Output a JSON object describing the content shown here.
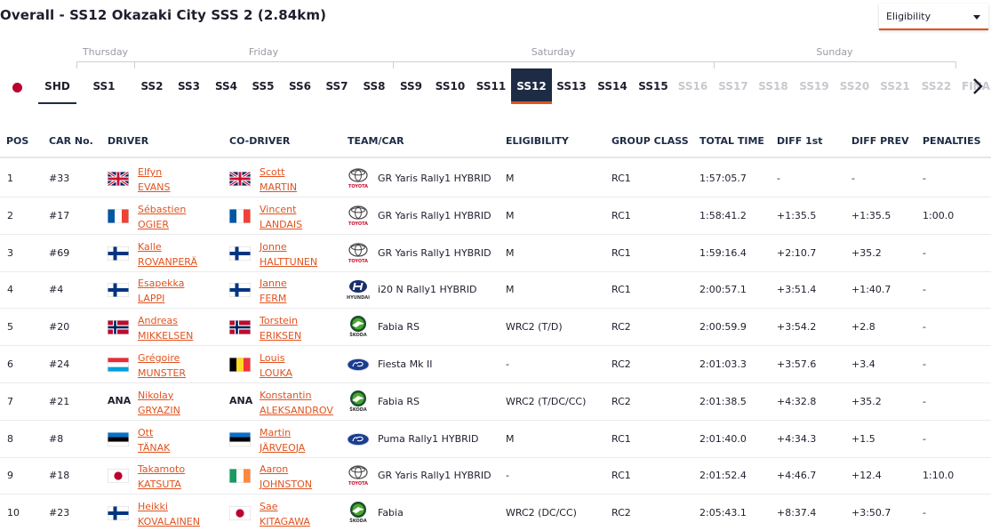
{
  "header": {
    "title": "Overall - SS12 Okazaki City SSS 2 (2.84km)"
  },
  "eligibility": {
    "label": "Eligibility"
  },
  "days": [
    "Thursday",
    "Friday",
    "Saturday",
    "Sunday"
  ],
  "stages": [
    {
      "label": "SHD",
      "state": "shd"
    },
    {
      "label": "SS1",
      "state": "done"
    },
    {
      "label": "SS2",
      "state": "done"
    },
    {
      "label": "SS3",
      "state": "done"
    },
    {
      "label": "SS4",
      "state": "done"
    },
    {
      "label": "SS5",
      "state": "done"
    },
    {
      "label": "SS6",
      "state": "done"
    },
    {
      "label": "SS7",
      "state": "done"
    },
    {
      "label": "SS8",
      "state": "done"
    },
    {
      "label": "SS9",
      "state": "done"
    },
    {
      "label": "SS10",
      "state": "done"
    },
    {
      "label": "SS11",
      "state": "done"
    },
    {
      "label": "SS12",
      "state": "active"
    },
    {
      "label": "SS13",
      "state": "done"
    },
    {
      "label": "SS14",
      "state": "done"
    },
    {
      "label": "SS15",
      "state": "done"
    },
    {
      "label": "SS16",
      "state": "future"
    },
    {
      "label": "SS17",
      "state": "future"
    },
    {
      "label": "SS18",
      "state": "future"
    },
    {
      "label": "SS19",
      "state": "future"
    },
    {
      "label": "SS20",
      "state": "future"
    },
    {
      "label": "SS21",
      "state": "future"
    },
    {
      "label": "SS22",
      "state": "future"
    },
    {
      "label": "FINAL",
      "state": "future"
    }
  ],
  "columns": {
    "pos": "POS",
    "car": "CAR No.",
    "driver": "DRIVER",
    "codriver": "CO-DRIVER",
    "team": "TEAM/CAR",
    "eligibility": "ELIGIBILITY",
    "group": "GROUP CLASS",
    "total": "TOTAL TIME",
    "diff1": "DIFF 1st",
    "diffprev": "DIFF PREV",
    "penalties": "PENALTIES"
  },
  "rows": [
    {
      "pos": "1",
      "car": "#33",
      "d_flag": "gb",
      "d_first": "Elfyn",
      "d_last": "EVANS",
      "c_flag": "gb",
      "c_first": "Scott",
      "c_last": "MARTIN",
      "brand": "toyota",
      "team": "GR Yaris Rally1 HYBRID",
      "elig": "M",
      "group": "RC1",
      "total": "1:57:05.7",
      "diff1": "-",
      "diffprev": "-",
      "pen": "-"
    },
    {
      "pos": "2",
      "car": "#17",
      "d_flag": "fr",
      "d_first": "Sébastien",
      "d_last": "OGIER",
      "c_flag": "fr",
      "c_first": "Vincent",
      "c_last": "LANDAIS",
      "brand": "toyota",
      "team": "GR Yaris Rally1 HYBRID",
      "elig": "M",
      "group": "RC1",
      "total": "1:58:41.2",
      "diff1": "+1:35.5",
      "diffprev": "+1:35.5",
      "pen": "1:00.0"
    },
    {
      "pos": "3",
      "car": "#69",
      "d_flag": "fi",
      "d_first": "Kalle",
      "d_last": "ROVANPERÄ",
      "c_flag": "fi",
      "c_first": "Jonne",
      "c_last": "HALTTUNEN",
      "brand": "toyota",
      "team": "GR Yaris Rally1 HYBRID",
      "elig": "M",
      "group": "RC1",
      "total": "1:59:16.4",
      "diff1": "+2:10.7",
      "diffprev": "+35.2",
      "pen": "-"
    },
    {
      "pos": "4",
      "car": "#4",
      "d_flag": "fi",
      "d_first": "Esapekka",
      "d_last": "LAPPI",
      "c_flag": "fi",
      "c_first": "Janne",
      "c_last": "FERM",
      "brand": "hyundai",
      "team": "i20 N Rally1 HYBRID",
      "elig": "M",
      "group": "RC1",
      "total": "2:00:57.1",
      "diff1": "+3:51.4",
      "diffprev": "+1:40.7",
      "pen": "-"
    },
    {
      "pos": "5",
      "car": "#20",
      "d_flag": "no",
      "d_first": "Andreas",
      "d_last": "MIKKELSEN",
      "c_flag": "no",
      "c_first": "Torstein",
      "c_last": "ERIKSEN",
      "brand": "skoda",
      "team": "Fabia RS",
      "elig": "WRC2 (T/D)",
      "group": "RC2",
      "total": "2:00:59.9",
      "diff1": "+3:54.2",
      "diffprev": "+2.8",
      "pen": "-"
    },
    {
      "pos": "6",
      "car": "#24",
      "d_flag": "lu",
      "d_first": "Grégoire",
      "d_last": "MUNSTER",
      "c_flag": "be",
      "c_first": "Louis",
      "c_last": "LOUKA",
      "brand": "ford",
      "team": "Fiesta Mk II",
      "elig": "-",
      "group": "RC2",
      "total": "2:01:03.3",
      "diff1": "+3:57.6",
      "diffprev": "+3.4",
      "pen": "-"
    },
    {
      "pos": "7",
      "car": "#21",
      "d_flag": "ana",
      "d_first": "Nikolay",
      "d_last": "GRYAZIN",
      "c_flag": "ana",
      "c_first": "Konstantin",
      "c_last": "ALEKSANDROV",
      "brand": "skoda",
      "team": "Fabia RS",
      "elig": "WRC2 (T/DC/CC)",
      "group": "RC2",
      "total": "2:01:38.5",
      "diff1": "+4:32.8",
      "diffprev": "+35.2",
      "pen": "-"
    },
    {
      "pos": "8",
      "car": "#8",
      "d_flag": "ee",
      "d_first": "Ott",
      "d_last": "TÄNAK",
      "c_flag": "ee",
      "c_first": "Martin",
      "c_last": "JÄRVEOJA",
      "brand": "ford",
      "team": "Puma Rally1 HYBRID",
      "elig": "M",
      "group": "RC1",
      "total": "2:01:40.0",
      "diff1": "+4:34.3",
      "diffprev": "+1.5",
      "pen": "-"
    },
    {
      "pos": "9",
      "car": "#18",
      "d_flag": "jp",
      "d_first": "Takamoto",
      "d_last": "KATSUTA",
      "c_flag": "ie",
      "c_first": "Aaron",
      "c_last": "JOHNSTON",
      "brand": "toyota",
      "team": "GR Yaris Rally1 HYBRID",
      "elig": "-",
      "group": "RC1",
      "total": "2:01:52.4",
      "diff1": "+4:46.7",
      "diffprev": "+12.4",
      "pen": "1:10.0"
    },
    {
      "pos": "10",
      "car": "#23",
      "d_flag": "fi",
      "d_first": "Heikki",
      "d_last": "KOVALAINEN",
      "c_flag": "jp",
      "c_first": "Sae",
      "c_last": "KITAGAWA",
      "brand": "skoda",
      "team": "Fabia",
      "elig": "WRC2 (DC/CC)",
      "group": "RC2",
      "total": "2:05:43.1",
      "diff1": "+8:37.4",
      "diffprev": "+3:50.7",
      "pen": "-"
    }
  ],
  "brand_labels": {
    "toyota": "TOYOTA",
    "hyundai": "HYUNDAI",
    "skoda": "ŠKODA"
  },
  "ana_label": "ANA",
  "colors": {
    "accent": "#e0531f",
    "navy": "#1e2b44",
    "future": "#c8c8ce"
  }
}
